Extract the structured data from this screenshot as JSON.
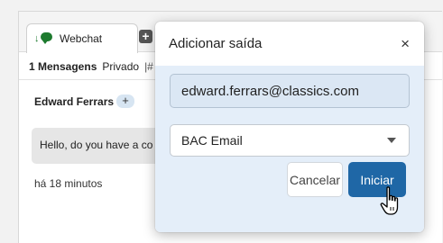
{
  "webchat": {
    "tab_label": "Webchat",
    "add_tab_symbol": "+",
    "message_count": "1 Mensagens",
    "visibility": "Privado",
    "meta_separator": "|#",
    "sender_name": "Edward Ferrars",
    "sender_add_symbol": "+",
    "message_text": "Hello, do you have a co",
    "timestamp": "há 18 minutos"
  },
  "modal": {
    "title": "Adicionar saída",
    "close_symbol": "×",
    "email_value": "edward.ferrars@classics.com",
    "channel_selected": "BAC Email",
    "cancel_label": "Cancelar",
    "start_label": "Iniciar"
  },
  "colors": {
    "primary_button": "#1f67a6",
    "modal_body_bg": "#e4eef9",
    "webchat_icon": "#1d7a2e"
  },
  "icons": {
    "tab_icon": "webchat-icon",
    "close": "close-icon",
    "dropdown": "chevron-down-icon",
    "pointer": "hand-pointer-icon"
  }
}
